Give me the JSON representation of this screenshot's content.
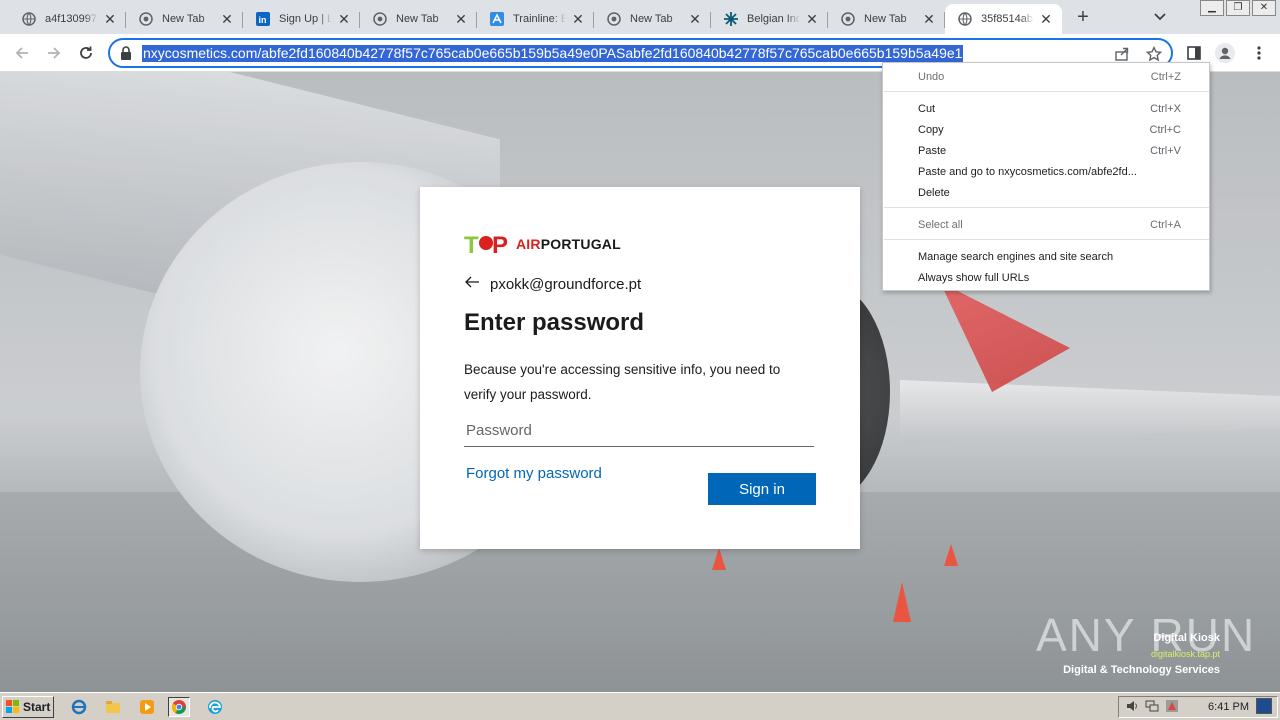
{
  "browser": {
    "tabs": [
      {
        "title": "a4f130997",
        "icon": "globe-icon",
        "active": false
      },
      {
        "title": "New Tab",
        "icon": "chrome-icon",
        "active": false
      },
      {
        "title": "Sign Up | Li",
        "icon": "linkedin-icon",
        "active": false
      },
      {
        "title": "New Tab",
        "icon": "chrome-icon",
        "active": false
      },
      {
        "title": "Trainline: Bu",
        "icon": "trainline-icon",
        "active": false
      },
      {
        "title": "New Tab",
        "icon": "chrome-icon",
        "active": false
      },
      {
        "title": "Belgian Ind",
        "icon": "snowflake-icon",
        "active": false
      },
      {
        "title": "New Tab",
        "icon": "chrome-icon",
        "active": false
      },
      {
        "title": "35f8514ab",
        "icon": "globe-icon",
        "active": true
      }
    ],
    "new_tab_label": "+",
    "url": "nxycosmetics.com/abfe2fd160840b42778f57c765cab0e665b159b5a49e0PASabfe2fd160840b42778f57c765cab0e665b159b5a49e1"
  },
  "context_menu": {
    "items": [
      {
        "label": "Undo",
        "shortcut": "Ctrl+Z",
        "disabled": true
      },
      {
        "label": "Cut",
        "shortcut": "Ctrl+X",
        "disabled": false
      },
      {
        "label": "Copy",
        "shortcut": "Ctrl+C",
        "disabled": false
      },
      {
        "label": "Paste",
        "shortcut": "Ctrl+V",
        "disabled": false
      },
      {
        "label": "Paste and go to nxycosmetics.com/abfe2fd...",
        "shortcut": "",
        "disabled": false
      },
      {
        "label": "Delete",
        "shortcut": "",
        "disabled": false
      },
      {
        "label": "Select all",
        "shortcut": "Ctrl+A",
        "disabled": true
      },
      {
        "label": "Manage search engines and site search",
        "shortcut": "",
        "disabled": false
      },
      {
        "label": "Always show full URLs",
        "shortcut": "",
        "disabled": false
      }
    ]
  },
  "login": {
    "brand_logo_text": "TAP",
    "brand_air": "AIR",
    "brand_portugal": "PORTUGAL",
    "email": "pxokk@groundforce.pt",
    "heading": "Enter password",
    "description": "Because you're accessing sensitive info, you need to verify your password.",
    "password_placeholder": "Password",
    "forgot_link": "Forgot my password",
    "signin_button": "Sign in"
  },
  "overlay": {
    "watermark": "ANY RUN",
    "kiosk_title": "Digital Kiosk",
    "kiosk_sub": "digitalkiosk.tap.pt",
    "kiosk_tagline": "Digital & Technology Services"
  },
  "taskbar": {
    "start_label": "Start",
    "clock": "6:41 PM"
  },
  "colors": {
    "omnibox_focus": "#1a73e8",
    "url_selection": "#3367d6",
    "signin_blue": "#0067b8",
    "tap_red": "#d9211f",
    "tap_green": "#8dc63f"
  }
}
